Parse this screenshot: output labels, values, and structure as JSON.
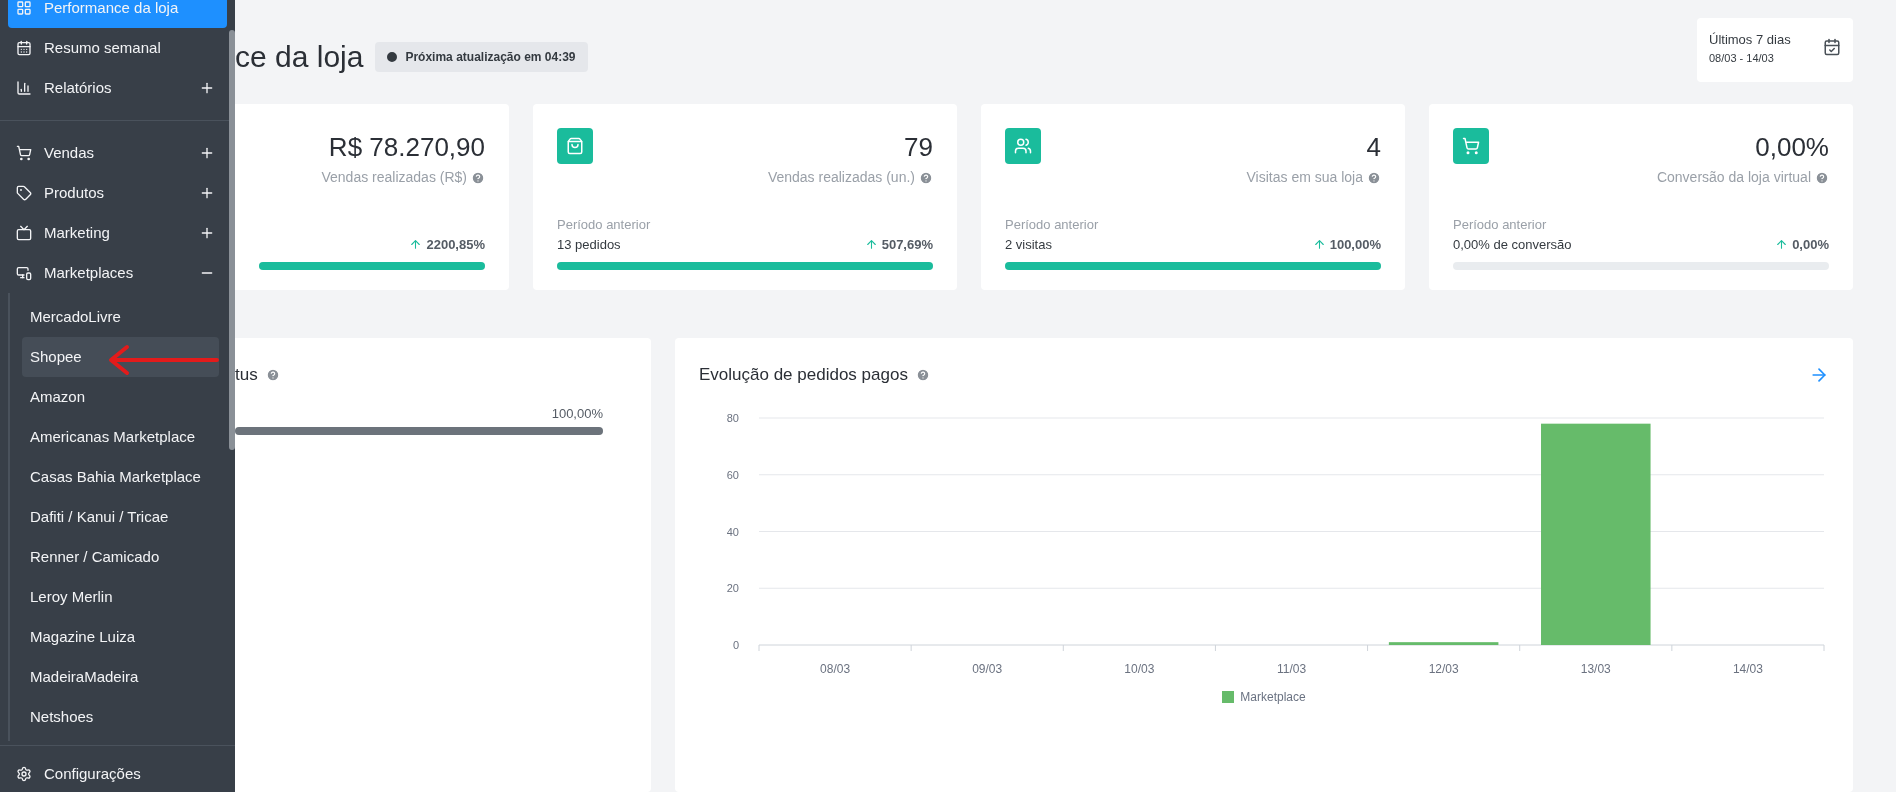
{
  "sidebar": {
    "top_items": [
      {
        "label": "Performance da loja",
        "selected": true
      },
      {
        "label": "Resumo semanal",
        "selected": false
      },
      {
        "label": "Relatórios",
        "selected": false,
        "expanded": false
      }
    ],
    "main_items": [
      {
        "label": "Vendas",
        "selected": false,
        "expanded": false
      },
      {
        "label": "Produtos",
        "selected": false,
        "expanded": false
      },
      {
        "label": "Marketing",
        "selected": false,
        "expanded": false
      },
      {
        "label": "Marketplaces",
        "selected": false,
        "expanded": true,
        "children": [
          {
            "label": "MercadoLivre",
            "selected": false
          },
          {
            "label": "Shopee",
            "selected": true
          },
          {
            "label": "Amazon",
            "selected": false
          },
          {
            "label": "Americanas Marketplace",
            "selected": false
          },
          {
            "label": "Casas Bahia Marketplace",
            "selected": false
          },
          {
            "label": "Dafiti / Kanui / Tricae",
            "selected": false
          },
          {
            "label": "Renner / Camicado",
            "selected": false
          },
          {
            "label": "Leroy Merlin",
            "selected": false
          },
          {
            "label": "Magazine Luiza",
            "selected": false
          },
          {
            "label": "MadeiraMadeira",
            "selected": false
          },
          {
            "label": "Netshoes",
            "selected": false
          }
        ]
      }
    ],
    "footer_item": {
      "label": "Configurações",
      "selected": false
    }
  },
  "header": {
    "title": "ce da loja",
    "update_badge": "Próxima atualização em 04:39",
    "date_range": {
      "label": "Últimos 7 dias",
      "dates": "08/03 - 14/03"
    }
  },
  "cards": [
    {
      "value": "R$ 78.270,90",
      "label": "Vendas realizadas (R$)",
      "change": "2200,85%",
      "level": 1
    },
    {
      "value": "79",
      "label": "Vendas realizadas (un.)",
      "previous_label": "Período anterior",
      "previous_value": "13 pedidos",
      "change": "507,69%",
      "level": 1
    },
    {
      "value": "4",
      "label": "Visitas em sua loja",
      "previous_label": "Período anterior",
      "previous_value": "2 visitas",
      "change": "100,00%",
      "level": 1
    },
    {
      "value": "0,00%",
      "label": "Conversão da loja virtual",
      "previous_label": "Período anterior",
      "previous_value": "0,00% de conversão",
      "change": "0,00%",
      "level": 0
    }
  ],
  "status_panel": {
    "title": "tus",
    "percent": "100,00%",
    "level": 1
  },
  "chart_panel": {
    "title": "Evolução de pedidos pagos",
    "chart_data": {
      "type": "bar",
      "categories": [
        "08/03",
        "09/03",
        "10/03",
        "11/03",
        "12/03",
        "13/03",
        "14/03"
      ],
      "series": [
        {
          "name": "Marketplace",
          "color": "#66bb6a",
          "values": [
            0,
            0,
            0,
            0,
            1,
            78,
            0
          ]
        }
      ],
      "ylim": [
        0,
        80
      ],
      "grid": true,
      "yticks": [
        0,
        20,
        40,
        60,
        80
      ]
    }
  }
}
